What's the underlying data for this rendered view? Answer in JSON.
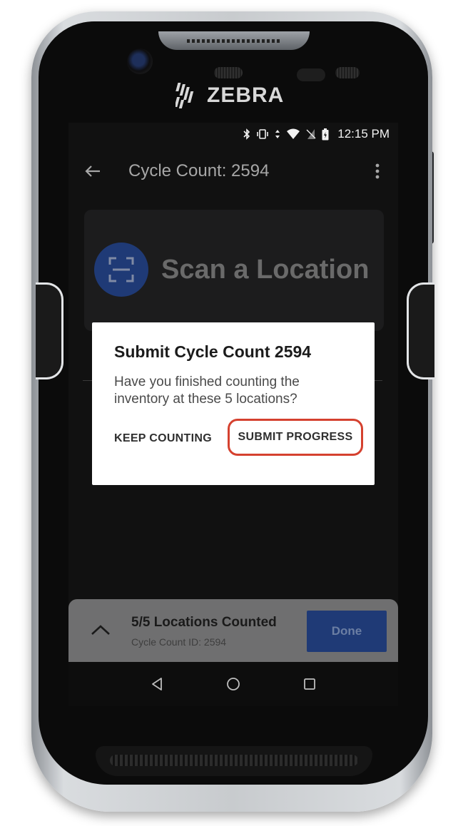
{
  "device": {
    "brand": "ZEBRA"
  },
  "status_bar": {
    "icons": [
      "bluetooth-icon",
      "vibrate-icon",
      "data-arrows-icon",
      "wifi-icon",
      "no-sim-icon",
      "battery-icon"
    ],
    "time": "12:15 PM"
  },
  "app_bar": {
    "back_icon": "arrow-left-icon",
    "title": "Cycle Count: 2594",
    "menu_icon": "more-vertical-icon"
  },
  "scan_card": {
    "icon": "scan-frame-icon",
    "label": "Scan a Location"
  },
  "dialog": {
    "title": "Submit Cycle Count 2594",
    "body": "Have you finished counting the inventory at these 5 locations?",
    "keep_label": "KEEP COUNTING",
    "submit_label": "SUBMIT PROGRESS",
    "highlight_color": "#d5412f"
  },
  "bottom_sheet": {
    "title": "5/5 Locations Counted",
    "subtitle": "Cycle Count ID: 2594",
    "done_label": "Done",
    "accent": "#1f3a76"
  },
  "nav_bar": {
    "buttons": [
      "back-triangle-icon",
      "home-circle-icon",
      "recents-square-icon"
    ]
  }
}
